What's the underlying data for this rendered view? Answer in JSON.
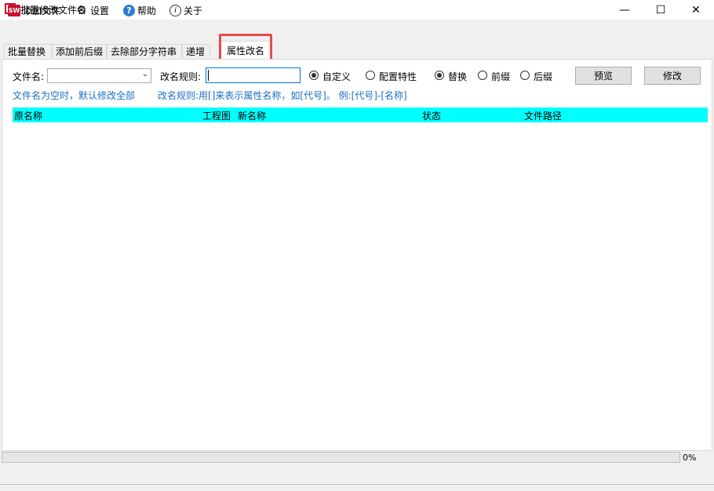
{
  "window": {
    "title": "批量修改文件名",
    "controls": {
      "minimize": "—",
      "maximize": "☐",
      "close": "✕"
    }
  },
  "toolbar": {
    "items": [
      {
        "label": "添加文件",
        "icon": "sw-file-icon"
      },
      {
        "label": "设置",
        "icon": "gear-icon"
      },
      {
        "label": "帮助",
        "icon": "help-icon"
      },
      {
        "label": "关于",
        "icon": "info-icon"
      }
    ]
  },
  "tabs": [
    {
      "label": "批量替换",
      "active": false
    },
    {
      "label": "添加前后缀",
      "active": false
    },
    {
      "label": "去除部分字符串",
      "active": false
    },
    {
      "label": "递增",
      "active": false
    },
    {
      "label": "属性改名",
      "active": true
    }
  ],
  "form": {
    "filename_label": "文件名:",
    "filename_value": "",
    "rule_label": "改名规则:",
    "rule_value": "",
    "source_options": [
      {
        "label": "自定义",
        "selected": true
      },
      {
        "label": "配置特性",
        "selected": false
      }
    ],
    "mode_options": [
      {
        "label": "替换",
        "selected": true
      },
      {
        "label": "前缀",
        "selected": false
      },
      {
        "label": "后缀",
        "selected": false
      }
    ],
    "preview_button": "预览",
    "modify_button": "修改",
    "hint_filename": "文件名为空时，默认修改全部",
    "hint_rule": "改名规则:用[]来表示属性名称，如[代号]。 例:[代号]-[名称]"
  },
  "table": {
    "columns": [
      "原名称",
      "工程图",
      "新名称",
      "状态",
      "文件路径"
    ],
    "rows": []
  },
  "progress": {
    "value": 0,
    "label": "0%"
  },
  "colors": {
    "header_bg": "#00ffff",
    "hint_text": "#1a6fc4",
    "highlight_border": "#e84a4a",
    "accent": "#0078d7"
  }
}
